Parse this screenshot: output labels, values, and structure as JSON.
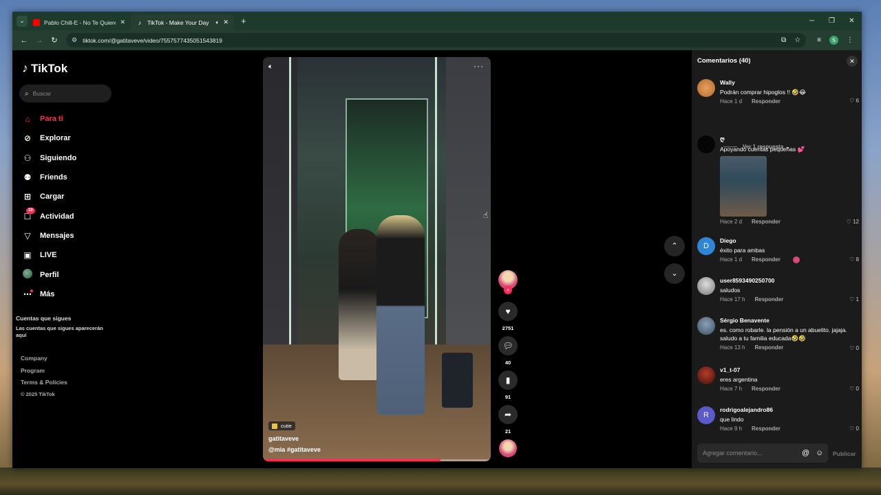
{
  "browser": {
    "tabs": [
      {
        "title": "Pablo Chill-E - No Te Quieren V",
        "active": false,
        "favicon": "youtube-icon"
      },
      {
        "title": "TikTok - Make Your Day",
        "active": true,
        "favicon": "tiktok-icon"
      }
    ],
    "url": "tiktok.com/@gatitaveve/video/7557577435051543819",
    "profile_initial": "s"
  },
  "sidebar": {
    "logo": "TikTok",
    "search_placeholder": "Buscar",
    "items": [
      {
        "label": "Para ti",
        "icon": "home-icon",
        "active": true
      },
      {
        "label": "Explorar",
        "icon": "compass-icon"
      },
      {
        "label": "Siguiendo",
        "icon": "user-plus-icon"
      },
      {
        "label": "Friends",
        "icon": "friends-icon"
      },
      {
        "label": "Cargar",
        "icon": "upload-icon"
      },
      {
        "label": "Actividad",
        "icon": "inbox-icon",
        "badge": "19"
      },
      {
        "label": "Mensajes",
        "icon": "send-icon"
      },
      {
        "label": "LIVE",
        "icon": "live-icon"
      },
      {
        "label": "Perfil",
        "icon": "profile-avatar"
      },
      {
        "label": "Más",
        "icon": "more-icon"
      }
    ],
    "following_title": "Cuentas que sigues",
    "following_desc": "Las cuentas que sigues aparecerán aquí",
    "footer": [
      "Company",
      "Program",
      "Terms & Policies"
    ],
    "copyright": "© 2025 TikTok"
  },
  "video": {
    "tag": "cutie",
    "author": "gatitaveve",
    "mention": "@mia",
    "hashtag": "#gatitaveve",
    "progress": 0.78,
    "likes": "2751",
    "comments": "40",
    "saves": "91",
    "shares": "21"
  },
  "comments": {
    "header": "Comentarios (40)",
    "input_placeholder": "Agregar comentario...",
    "post_label": "Publicar",
    "reply_label": "Responder",
    "items": [
      {
        "user": "Wally",
        "text": "Podrán comprar hipoglos !! 🤣😂",
        "time": "Hace 1 d",
        "likes": "6",
        "view_replies": "Ver 1 respuesta"
      },
      {
        "user": "ღ",
        "text": "Apoyando cuentas pequeñas 💕",
        "time": "Hace 2 d",
        "likes": "12"
      },
      {
        "user": "Diego",
        "text": "éxito para ambas",
        "time": "Hace 1 d",
        "likes": "8",
        "initial": "D"
      },
      {
        "user": "user8593490250700",
        "text": "saludos",
        "time": "Hace 17 h",
        "likes": "1"
      },
      {
        "user": "Sérgio Benavente",
        "text": "es. como robarle. la pensión a un abuelito. jajaja. saludo a tu familia educada🤣🤣",
        "time": "Hace 13 h",
        "likes": "0"
      },
      {
        "user": "v1_t-07",
        "text": "eres argentina",
        "time": "Hace 7 h",
        "likes": "0"
      },
      {
        "user": "rodrigoalejandro86",
        "text": "que lindo",
        "time": "Hace 9 h",
        "likes": "0",
        "initial": "R"
      }
    ]
  }
}
